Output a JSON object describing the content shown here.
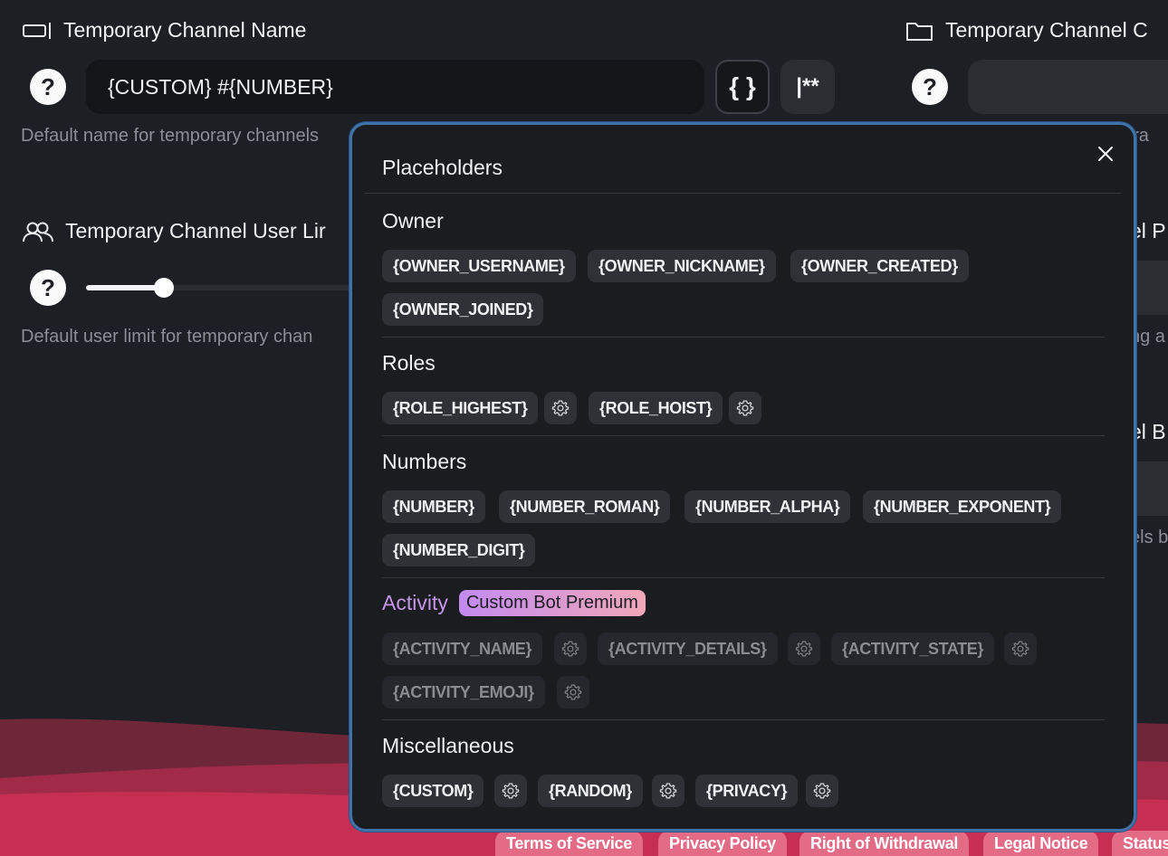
{
  "fields": {
    "name": {
      "title": "Temporary Channel Name",
      "value": "{CUSTOM} #{NUMBER}",
      "placeholder_btn": "{ }",
      "format_btn": "|**",
      "help": "Default name for temporary channels"
    },
    "category": {
      "title": "Temporary Channel C",
      "help": "ora"
    },
    "user_limit": {
      "title": "Temporary Channel User Lir",
      "help": "Default user limit for temporary chan",
      "slider_fraction": 0.0
    },
    "right_p": {
      "title": "el P",
      "help": "ng a"
    },
    "right_b": {
      "title": "el B",
      "help": "els b"
    }
  },
  "popup": {
    "title": "Placeholders",
    "sections": {
      "owner": {
        "title": "Owner",
        "chips": [
          "{OWNER_USERNAME}",
          "{OWNER_NICKNAME}",
          "{OWNER_CREATED}",
          "{OWNER_JOINED}"
        ]
      },
      "roles": {
        "title": "Roles",
        "chips": [
          "{ROLE_HIGHEST}",
          "{ROLE_HOIST}"
        ]
      },
      "numbers": {
        "title": "Numbers",
        "chips": [
          "{NUMBER}",
          "{NUMBER_ROMAN}",
          "{NUMBER_ALPHA}",
          "{NUMBER_EXPONENT}",
          "{NUMBER_DIGIT}"
        ]
      },
      "activity": {
        "title": "Activity",
        "badge": "Custom Bot Premium",
        "chips": [
          "{ACTIVITY_NAME}",
          "{ACTIVITY_DETAILS}",
          "{ACTIVITY_STATE}",
          "{ACTIVITY_EMOJI}"
        ]
      },
      "misc": {
        "title": "Miscellaneous",
        "chips": [
          "{CUSTOM}",
          "{RANDOM}",
          "{PRIVACY}"
        ]
      }
    }
  },
  "footer": {
    "links": [
      "Terms of Service",
      "Privacy Policy",
      "Right of Withdrawal",
      "Legal Notice",
      "Status"
    ]
  },
  "colors": {
    "background": "#1d1f24",
    "wave_dark": "#6e2639",
    "wave_mid": "#a02a48",
    "wave_light": "#c72f52",
    "popup_border": "#3f73a8",
    "premium_from": "#c38af0",
    "premium_to": "#f0a8b8"
  },
  "icons": {
    "name_field": "input-field-icon",
    "category_field": "folder-icon",
    "user_limit_field": "users-icon",
    "help": "question-icon",
    "close": "close-icon",
    "settings": "gear-icon"
  }
}
